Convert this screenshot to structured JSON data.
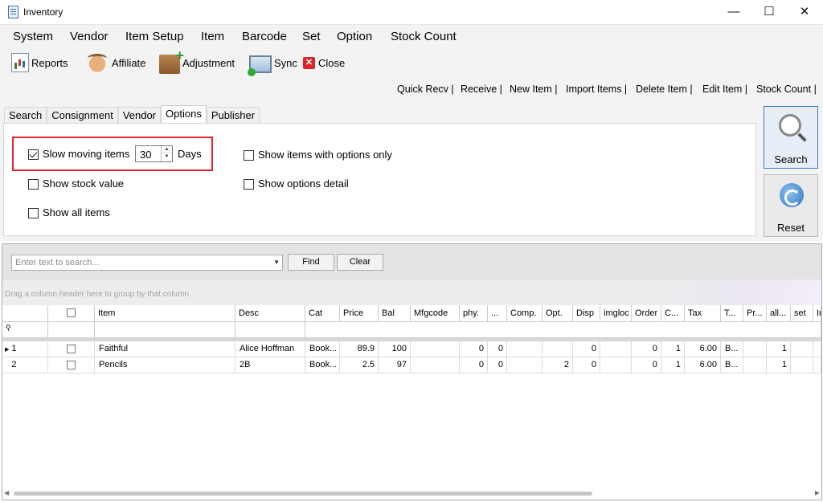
{
  "window": {
    "title": "Inventory",
    "minimize": "—",
    "maximize": "☐",
    "close": "✕"
  },
  "menu": [
    "System",
    "Vendor",
    "Item Setup",
    "Item",
    "Barcode",
    "Set",
    "Option",
    "Stock Count"
  ],
  "toolbar": {
    "reports": "Reports",
    "affiliate": "Affiliate",
    "adjustment": "Adjustment",
    "sync": "Sync",
    "close": "Close"
  },
  "quick_links": [
    "Quick Recv |",
    "Receive |",
    "New Item |",
    "Import Items |",
    "Delete Item |",
    "Edit Item |",
    "Stock Count |"
  ],
  "tabs": [
    "Search",
    "Consignment",
    "Vendor",
    "Options",
    "Publisher"
  ],
  "options": {
    "slow_moving_label": "Slow moving items",
    "slow_moving_checked": true,
    "slow_moving_days": "30",
    "days_label": "Days",
    "show_stock_value": "Show stock value",
    "show_all_items": "Show all items",
    "show_items_with_options": "Show items with options only",
    "show_options_detail": "Show options detail"
  },
  "buttons": {
    "search": "Search",
    "reset": "Reset"
  },
  "grid": {
    "search_placeholder": "Enter text to search...",
    "find": "Find",
    "clear": "Clear",
    "group_hint": "Drag a column header here to group by that column",
    "filter_icon": "funnel-icon",
    "columns": [
      "",
      "",
      "Item",
      "Desc",
      "Cat",
      "Price",
      "Bal",
      "Mfgcode",
      "phy.",
      "...",
      "Comp.",
      "Opt.",
      "Disp",
      "imgloc",
      "Order",
      "C...",
      "Tax",
      "T...",
      "Pr...",
      "all...",
      "set",
      "Ir"
    ],
    "rows": [
      {
        "rownum": "1",
        "item": "Faithful",
        "desc": "Alice Hoffman",
        "cat": "Book...",
        "price": "89.9",
        "bal": "100",
        "mfgcode": "",
        "phy": "0",
        "dots": "0",
        "comp": "",
        "opt": "",
        "disp": "0",
        "imgloc": "",
        "order": "0",
        "c": "1",
        "tax": "6.00",
        "t": "B...",
        "pr": "",
        "all": "1",
        "set": ""
      },
      {
        "rownum": "2",
        "item": "Pencils",
        "desc": "2B",
        "cat": "Book...",
        "price": "2.5",
        "bal": "97",
        "mfgcode": "",
        "phy": "0",
        "dots": "0",
        "comp": "",
        "opt": "2",
        "disp": "0",
        "imgloc": "",
        "order": "0",
        "c": "1",
        "tax": "6.00",
        "t": "B...",
        "pr": "",
        "all": "1",
        "set": ""
      }
    ]
  },
  "colors": {
    "highlight_box": "#e0262e",
    "selected_button": "#3a7cc8"
  }
}
